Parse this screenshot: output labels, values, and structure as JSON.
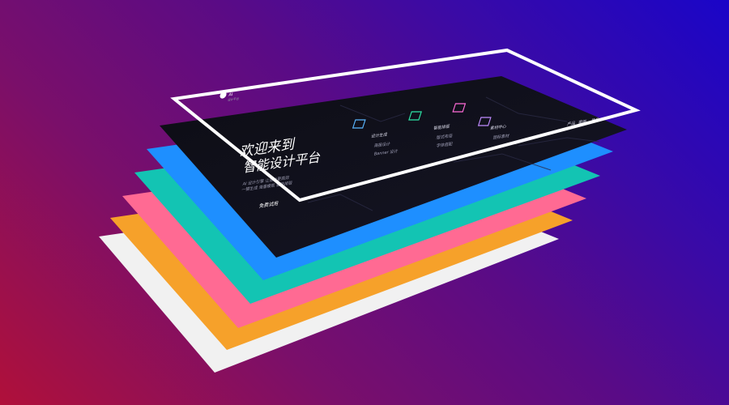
{
  "hero": {
    "brand": "AI",
    "brand_sub": "设计平台",
    "headline_line1": "欢迎来到",
    "headline_line2": "智能设计平台",
    "small_text_1": "Intelligent",
    "desc_line1": "AI 设计引擎 让设计更高效",
    "desc_line2": "一键生成 海量模板 智能排版",
    "cta": "免费试用",
    "features": [
      {
        "label": "设计生成",
        "item1": "海报设计",
        "item2": "Banner 设计"
      },
      {
        "label": "智能排版",
        "item1": "版式布局",
        "item2": "字体搭配"
      },
      {
        "label": "素材中心",
        "item1": "图标素材",
        "item2": "插画素材"
      }
    ],
    "nav": [
      "产品",
      "案例",
      "登录"
    ]
  },
  "layers": [
    {
      "name": "layer-dark",
      "color": "#0b0b10"
    },
    {
      "name": "layer-blue",
      "color": "#1e8fff"
    },
    {
      "name": "layer-teal",
      "color": "#13c4b3"
    },
    {
      "name": "layer-pink",
      "color": "#ff6a93"
    },
    {
      "name": "layer-orange",
      "color": "#f6a12a"
    },
    {
      "name": "layer-white",
      "color": "#f1f1f1"
    }
  ],
  "frame_color": "#ffffff"
}
